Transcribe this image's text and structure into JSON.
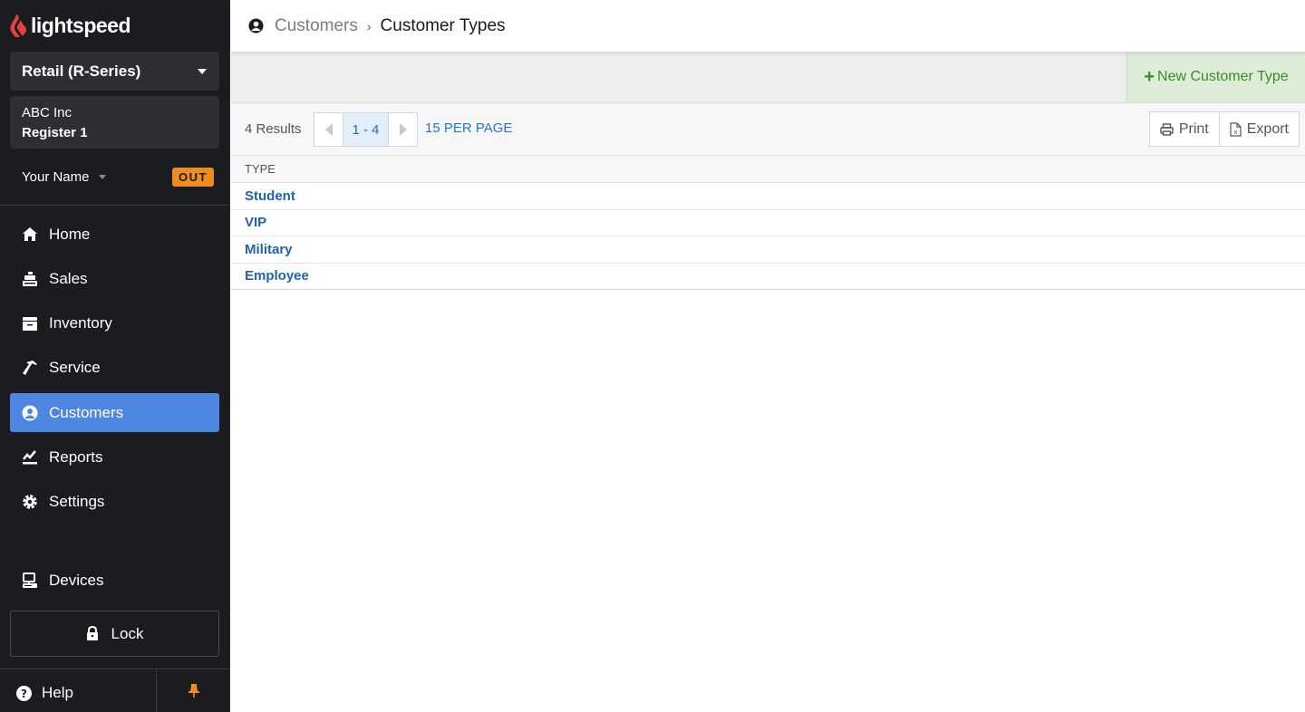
{
  "app": {
    "brand": "lightspeed",
    "colors": {
      "sidebar_bg": "#1b1c20",
      "accent": "#4e86e4",
      "brand_red": "#e8413d",
      "out_badge": "#ef8b1f",
      "new_button_bg": "#deedd8",
      "new_button_text": "#3a8a2a",
      "link": "#1f62b4"
    }
  },
  "sidebar": {
    "store_select": "Retail (R-Series)",
    "company": "ABC Inc",
    "register": "Register 1",
    "user_name": "Your Name",
    "status_badge": "OUT",
    "nav": [
      {
        "label": "Home",
        "icon": "home-icon",
        "active": false
      },
      {
        "label": "Sales",
        "icon": "cash-register-icon",
        "active": false
      },
      {
        "label": "Inventory",
        "icon": "archive-box-icon",
        "active": false
      },
      {
        "label": "Service",
        "icon": "hammer-icon",
        "active": false
      },
      {
        "label": "Customers",
        "icon": "user-circle-icon",
        "active": true
      },
      {
        "label": "Reports",
        "icon": "chart-line-icon",
        "active": false
      },
      {
        "label": "Settings",
        "icon": "gear-icon",
        "active": false
      }
    ],
    "devices_label": "Devices",
    "lock_label": "Lock",
    "help_label": "Help"
  },
  "header": {
    "breadcrumb_parent": "Customers",
    "breadcrumb_current": "Customer Types"
  },
  "actions": {
    "new_button": "New Customer Type"
  },
  "toolbar": {
    "results": "4 Results",
    "page_range": "1 - 4",
    "per_page": "15 PER PAGE",
    "print": "Print",
    "export": "Export"
  },
  "table": {
    "columns": [
      "TYPE"
    ],
    "rows": [
      "Student",
      "VIP",
      "Military",
      "Employee"
    ]
  }
}
